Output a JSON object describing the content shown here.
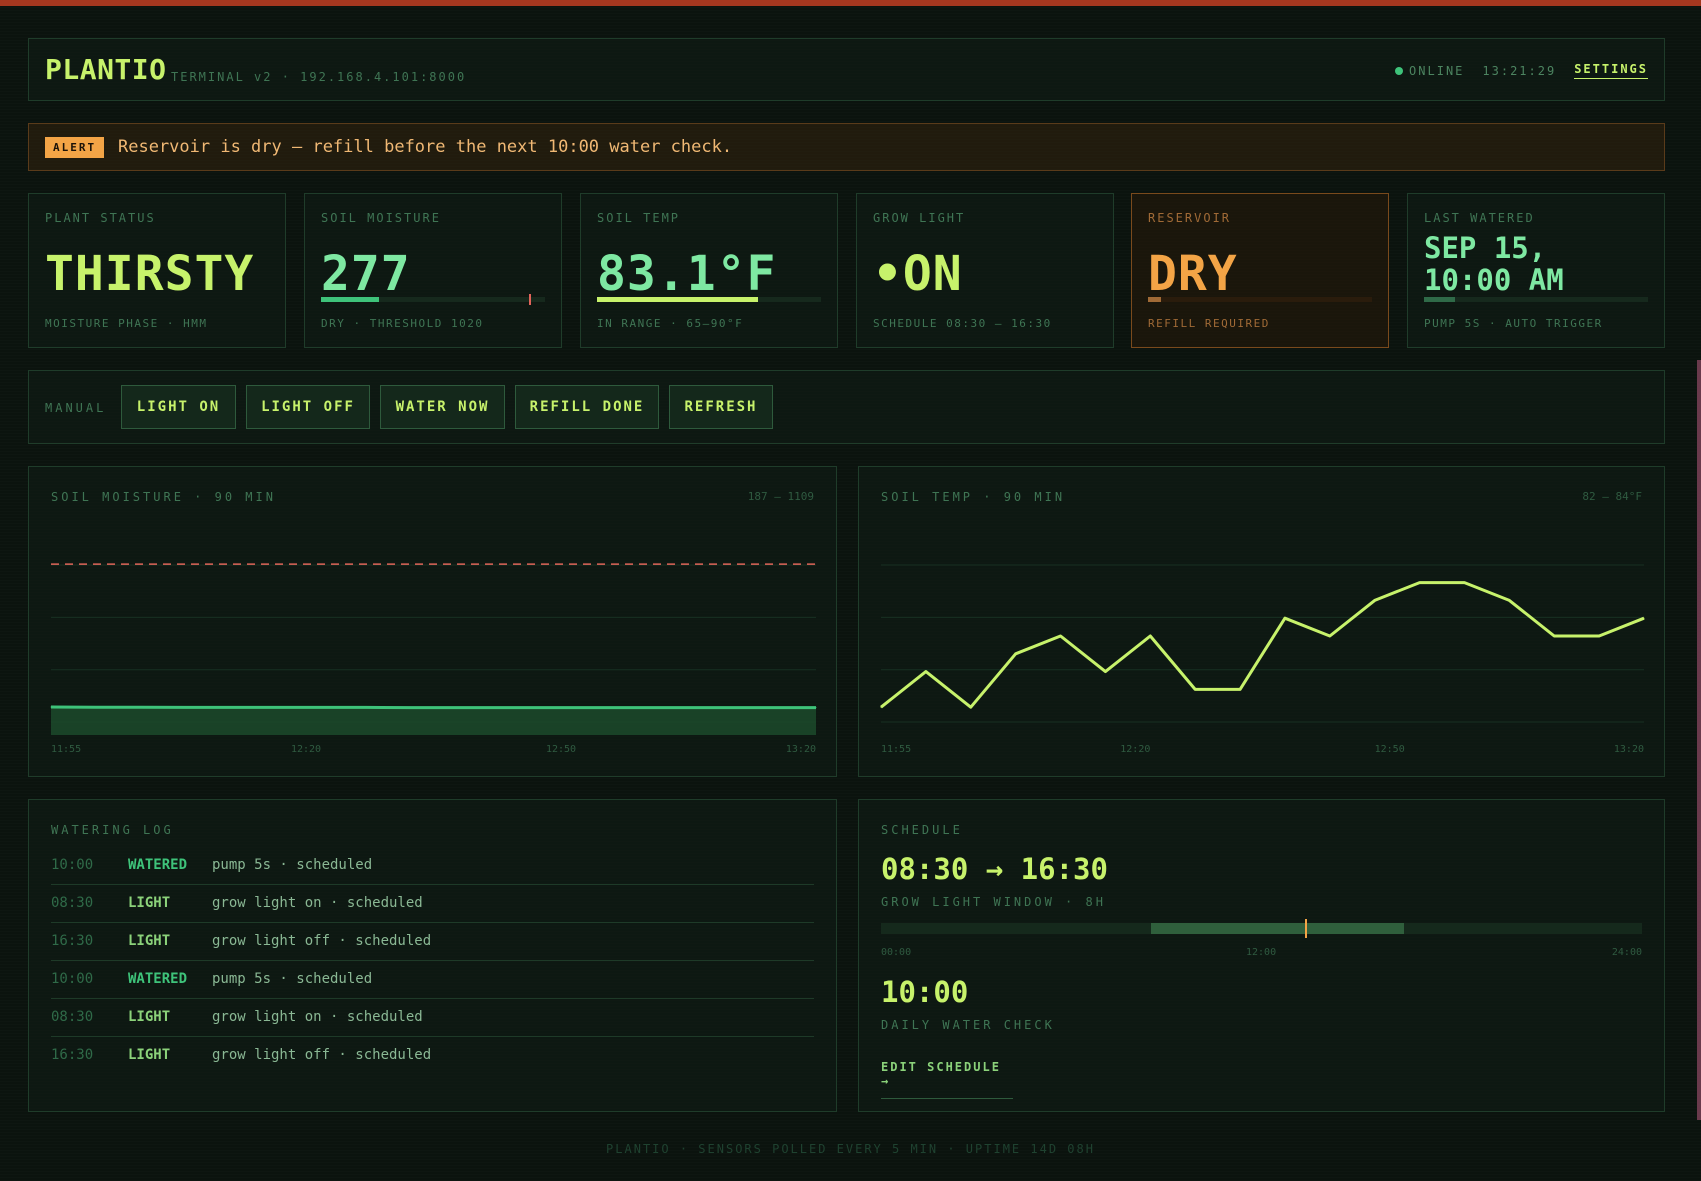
{
  "header": {
    "brand": "PLANTIO",
    "subtitle": "TERMINAL v2 · 192.168.4.101:8000",
    "status": "ONLINE",
    "clock": "13:21:29",
    "settings_label": "SETTINGS"
  },
  "alert": {
    "badge": "ALERT",
    "text": "Reservoir is dry — refill before the next 10:00 water check."
  },
  "cards": {
    "plant_status": {
      "label": "PLANT STATUS",
      "value": "THIRSTY",
      "foot": "MOISTURE PHASE · HMM"
    },
    "soil_moisture": {
      "label": "SOIL MOISTURE",
      "value": "277",
      "foot": "DRY · THRESHOLD 1020",
      "bar_fraction": 0.26
    },
    "soil_temp": {
      "label": "SOIL TEMP",
      "value": "83.1°F",
      "foot": "IN RANGE · 65–90°F",
      "bar_fraction": 0.72
    },
    "grow_light": {
      "label": "GROW LIGHT",
      "dot": "•",
      "value": "ON",
      "foot": "SCHEDULE 08:30 – 16:30"
    },
    "reservoir": {
      "label": "RESERVOIR",
      "value": "DRY",
      "foot": "REFILL REQUIRED",
      "bar_fraction": 0.06
    },
    "last_watered": {
      "label": "LAST WATERED",
      "value_line1": "SEP 15,",
      "value_line2": "10:00 AM",
      "foot": "PUMP 5S · AUTO TRIGGER",
      "bar_fraction": 0.14
    }
  },
  "manual": {
    "label": "MANUAL",
    "buttons": [
      "LIGHT ON",
      "LIGHT OFF",
      "WATER NOW",
      "REFILL DONE",
      "REFRESH"
    ]
  },
  "chart_data": [
    {
      "type": "area",
      "title": "SOIL MOISTURE · 90 MIN",
      "range_label": "187 – 1109",
      "x_ticks": [
        "11:55",
        "12:20",
        "12:50",
        "13:20"
      ],
      "ylim": [
        187,
        1109
      ],
      "threshold": 1020,
      "values": [
        280,
        279,
        279,
        278,
        278,
        278,
        278,
        278,
        277,
        277,
        277,
        277,
        277,
        277,
        277,
        277,
        277,
        277
      ]
    },
    {
      "type": "line",
      "title": "SOIL TEMP · 90 MIN",
      "range_label": "82 – 84°F",
      "x_ticks": [
        "11:55",
        "12:20",
        "12:50",
        "13:20"
      ],
      "ylim": [
        82,
        84
      ],
      "values": [
        82.2,
        82.6,
        82.2,
        82.8,
        83.0,
        82.6,
        83.0,
        82.4,
        82.4,
        83.2,
        83.0,
        83.4,
        83.6,
        83.6,
        83.4,
        83.0,
        83.0,
        83.2
      ]
    }
  ],
  "log": {
    "title": "WATERING LOG",
    "rows": [
      {
        "time": "10:00",
        "kind": "WATERED",
        "desc": "pump 5s · scheduled"
      },
      {
        "time": "08:30",
        "kind": "LIGHT",
        "desc": "grow light on · scheduled"
      },
      {
        "time": "16:30",
        "kind": "LIGHT",
        "desc": "grow light off · scheduled"
      },
      {
        "time": "10:00",
        "kind": "WATERED",
        "desc": "pump 5s · scheduled"
      },
      {
        "time": "08:30",
        "kind": "LIGHT",
        "desc": "grow light on · scheduled"
      },
      {
        "time": "16:30",
        "kind": "LIGHT",
        "desc": "grow light off · scheduled"
      }
    ]
  },
  "schedule": {
    "title": "SCHEDULE",
    "light_window": "08:30 → 16:30",
    "light_label": "GROW LIGHT WINDOW · 8H",
    "window_start_hour": 8.5,
    "window_end_hour": 16.5,
    "now_hour": 13.36,
    "ticks": [
      "00:00",
      "12:00",
      "24:00"
    ],
    "water_time": "10:00",
    "water_label": "DAILY WATER CHECK",
    "edit_label": "EDIT SCHEDULE →"
  },
  "footer": "PLANTIO · SENSORS POLLED EVERY 5 MIN · UPTIME 14D 08H",
  "colors": {
    "accent": "#c7f26b",
    "green": "#3ec37a",
    "warn": "#f3a446",
    "threshold": "#e0645a"
  }
}
